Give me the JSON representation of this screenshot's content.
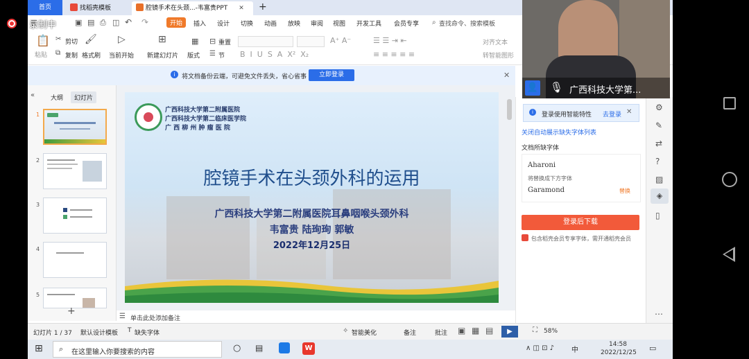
{
  "recorder": {
    "label": "录制中"
  },
  "tabs": [
    {
      "label": "首页"
    },
    {
      "label": "找稻壳模板"
    },
    {
      "label": "腔镜手术在头颈...-韦富贵PPT"
    }
  ],
  "menu": [
    "开始",
    "插入",
    "设计",
    "切换",
    "动画",
    "放映",
    "审阅",
    "视图",
    "开发工具",
    "会员专享"
  ],
  "search": {
    "placeholder": "查找命令、搜索模板"
  },
  "ribbon": {
    "paste": "粘贴",
    "cut": "剪切",
    "copy": "复制",
    "format_painter": "格式刷",
    "from_current": "当前开始",
    "new_slide": "新建幻灯片",
    "layout": "版式",
    "section": "节",
    "reset": "重置",
    "align_text": "对齐文本",
    "smartart": "转智能图形"
  },
  "cloud_bar": {
    "message": "将文档备份云端，可避免文件丢失，省心省事",
    "login": "立即登录"
  },
  "left_panel": {
    "tab_outline": "大纲",
    "tab_slides": "幻灯片",
    "slides": [
      "1",
      "2",
      "3",
      "4",
      "5"
    ]
  },
  "slide": {
    "hospital_lines": [
      "广西科技大学第二附属医院",
      "广西科技大学第二临床医学院",
      "广 西 柳 州 肿 瘤 医 院"
    ],
    "title": "腔镜手术在头颈外科的运用",
    "department": "广西科技大学第二附属医院耳鼻咽喉头颈外科",
    "authors": "韦富贵 陆珣珣 郭敏",
    "date": "2022年12月25日"
  },
  "notes": {
    "placeholder": "单击此处添加备注"
  },
  "right_panel": {
    "login_tip": "登录使用智能特性",
    "go_login": "去登录",
    "auto_show": "关闭自动展示缺失字体列表",
    "missing_fonts_title": "文档所缺字体",
    "font1": "Aharoni",
    "replace_tip": "将替换成下方字体",
    "font2": "Garamond",
    "font2_action": "替换",
    "download_btn": "登录后下载",
    "member_tip": "包含稻壳会员专享字体，需开通稻壳会员"
  },
  "video": {
    "name": "广西科技大学第..."
  },
  "status": {
    "slide_count": "幻灯片 1 / 37",
    "template": "默认设计模板",
    "missing_font": "缺失字体",
    "beautify": "智能美化",
    "notes": "备注",
    "comments": "批注",
    "zoom": "58%"
  },
  "taskbar": {
    "search_placeholder": "在这里输入你要搜索的内容",
    "time": "14:58",
    "date": "2022/12/25",
    "ime": "中"
  },
  "colors": {
    "accent": "#2b6de8",
    "orange": "#f07a2a",
    "download": "#f25a3a"
  }
}
